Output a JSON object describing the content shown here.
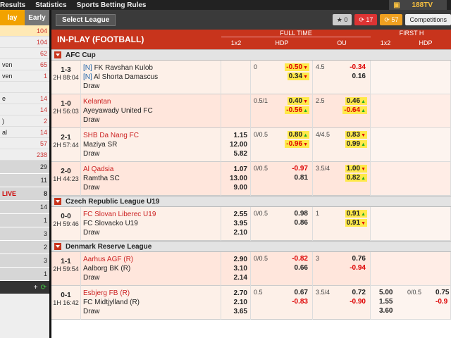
{
  "topbar": {
    "items": [
      "Results",
      "Statistics",
      "Sports Betting Rules"
    ],
    "brand": "188TV"
  },
  "left": {
    "tabs": [
      "lay",
      "Early"
    ],
    "rows": [
      {
        "label": "",
        "n": "104",
        "style": "hl"
      },
      {
        "label": "",
        "n": "104"
      },
      {
        "label": "",
        "n": "62"
      },
      {
        "label": "ven",
        "n": "65"
      },
      {
        "label": "ven",
        "n": "1"
      },
      {
        "label": "",
        "n": ""
      },
      {
        "label": "e",
        "n": "14"
      },
      {
        "label": "",
        "n": "14"
      },
      {
        "label": ")",
        "n": "2"
      },
      {
        "label": "al",
        "n": "14"
      },
      {
        "label": "",
        "n": "57"
      },
      {
        "label": "",
        "n": "238"
      }
    ],
    "grey_rows": [
      {
        "label": "",
        "n": "29"
      },
      {
        "label": "",
        "n": "11"
      },
      {
        "label": "LIVE",
        "n": "8"
      },
      {
        "label": "",
        "n": "14"
      },
      {
        "label": "",
        "n": "1"
      },
      {
        "label": "",
        "n": "3"
      },
      {
        "label": "",
        "n": "2"
      },
      {
        "label": "",
        "n": "3"
      },
      {
        "label": "",
        "n": "1"
      }
    ]
  },
  "toolbar": {
    "select_league": "Select League",
    "fav": "0",
    "count1": "17",
    "count2": "57",
    "competitions": "Competitions"
  },
  "header": {
    "title": "IN-PLAY (FOOTBALL)",
    "full_time": "FULL TIME",
    "first_half": "FIRST H",
    "cols": [
      "1x2",
      "HDP",
      "OU",
      "1x2",
      "HDP"
    ]
  },
  "leagues": [
    {
      "name": "AFC Cup",
      "matches": [
        {
          "score": "1-3",
          "time": "2H 88:04",
          "home": "FK Ravshan Kulob",
          "away": "Al Shorta Damascus",
          "draw": "Draw",
          "home_tag": "[N]",
          "away_tag": "[N]",
          "home_red": false,
          "x12": [
            "",
            "",
            ""
          ],
          "hdp_line": "0",
          "hdp": [
            "-0.50",
            "0.34"
          ],
          "ou_line": "4.5",
          "ou": [
            "-0.34",
            "0.16"
          ]
        },
        {
          "score": "1-0",
          "time": "2H 56:03",
          "home": "Kelantan",
          "away": "Ayeyawady United FC",
          "draw": "Draw",
          "home_red": true,
          "x12": [
            "",
            "",
            ""
          ],
          "hdp_line": "0.5/1",
          "hdp": [
            "0.40",
            "-0.56"
          ],
          "ou_line": "2.5",
          "ou": [
            "0.46",
            "-0.64"
          ]
        },
        {
          "score": "2-1",
          "time": "2H 57:44",
          "home": "SHB Da Nang FC",
          "away": "Maziya SR",
          "draw": "Draw",
          "home_red": true,
          "x12": [
            "1.15",
            "12.00",
            "5.82"
          ],
          "hdp_line": "0/0.5",
          "hdp": [
            "0.80",
            "-0.96"
          ],
          "ou_line": "4/4.5",
          "ou": [
            "0.83",
            "0.99"
          ]
        },
        {
          "score": "2-0",
          "time": "1H 44:23",
          "home": "Al Qadsia",
          "away": "Ramtha SC",
          "draw": "Draw",
          "home_red": true,
          "x12": [
            "1.07",
            "13.00",
            "9.00"
          ],
          "hdp_line": "0/0.5",
          "hdp": [
            "-0.97",
            "0.81"
          ],
          "ou_line": "3.5/4",
          "ou": [
            "1.00",
            "0.82"
          ]
        }
      ]
    },
    {
      "name": "Czech Republic League U19",
      "matches": [
        {
          "score": "0-0",
          "time": "2H 59:46",
          "home": "FC Slovan Liberec U19",
          "away": "FC Slovacko U19",
          "draw": "Draw",
          "home_red": true,
          "x12": [
            "2.55",
            "3.95",
            "2.10"
          ],
          "hdp_line": "0/0.5",
          "hdp": [
            "0.98",
            "0.86"
          ],
          "ou_line": "1",
          "ou": [
            "0.91",
            "0.91"
          ]
        }
      ]
    },
    {
      "name": "Denmark Reserve League",
      "matches": [
        {
          "score": "1-1",
          "time": "2H 59:54",
          "home": "Aarhus AGF (R)",
          "away": "Aalborg BK (R)",
          "draw": "Draw",
          "home_red": true,
          "x12": [
            "2.90",
            "3.10",
            "2.14"
          ],
          "hdp_line": "0/0.5",
          "hdp": [
            "-0.82",
            "0.66"
          ],
          "ou_line": "3",
          "ou": [
            "0.76",
            "-0.94"
          ]
        },
        {
          "score": "0-1",
          "time": "1H 16:42",
          "home": "Esbjerg FB (R)",
          "away": "FC Midtjylland (R)",
          "draw": "Draw",
          "home_red": true,
          "x12": [
            "2.70",
            "2.10",
            "3.65"
          ],
          "hdp_line": "0.5",
          "hdp": [
            "0.67",
            "-0.83"
          ],
          "ou_line": "3.5/4",
          "ou": [
            "0.72",
            "-0.90"
          ],
          "fh_x12": [
            "5.00",
            "1.55",
            "3.60"
          ],
          "fh_hdp_line": "0/0.5",
          "fh_hdp": [
            "0.75",
            "-0.9"
          ]
        }
      ]
    }
  ],
  "colors": {
    "accent": "#c8341c",
    "highlight": "#ffe94a",
    "negative": "#d00000",
    "today_tab": "#f2a200"
  }
}
